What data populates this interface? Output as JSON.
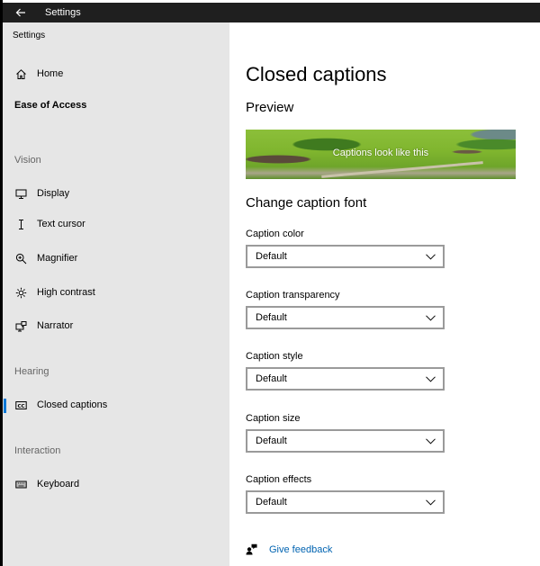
{
  "titlebar": {
    "title": "Settings",
    "back_icon": "arrow-left-icon"
  },
  "sidebar": {
    "app_label": "Settings",
    "home": {
      "label": "Home",
      "icon": "home-icon"
    },
    "category": "Ease of Access",
    "sections": [
      {
        "title": "Vision",
        "items": [
          {
            "label": "Display",
            "icon": "monitor-icon"
          },
          {
            "label": "Text cursor",
            "icon": "text-cursor-icon"
          },
          {
            "label": "Magnifier",
            "icon": "magnifier-icon"
          },
          {
            "label": "High contrast",
            "icon": "sun-icon"
          },
          {
            "label": "Narrator",
            "icon": "narrator-icon"
          }
        ]
      },
      {
        "title": "Hearing",
        "items": [
          {
            "label": "Closed captions",
            "icon": "cc-icon",
            "selected": true
          }
        ]
      },
      {
        "title": "Interaction",
        "items": [
          {
            "label": "Keyboard",
            "icon": "keyboard-icon"
          }
        ]
      }
    ],
    "accent_color": "#0078d7"
  },
  "main": {
    "title": "Closed captions",
    "preview_heading": "Preview",
    "preview_caption": "Captions look like this",
    "font_heading": "Change caption font",
    "fields": [
      {
        "label": "Caption color",
        "value": "Default"
      },
      {
        "label": "Caption transparency",
        "value": "Default"
      },
      {
        "label": "Caption style",
        "value": "Default"
      },
      {
        "label": "Caption size",
        "value": "Default"
      },
      {
        "label": "Caption effects",
        "value": "Default"
      }
    ],
    "feedback": {
      "label": "Give feedback",
      "icon": "feedback-icon",
      "color": "#0063b1"
    }
  }
}
